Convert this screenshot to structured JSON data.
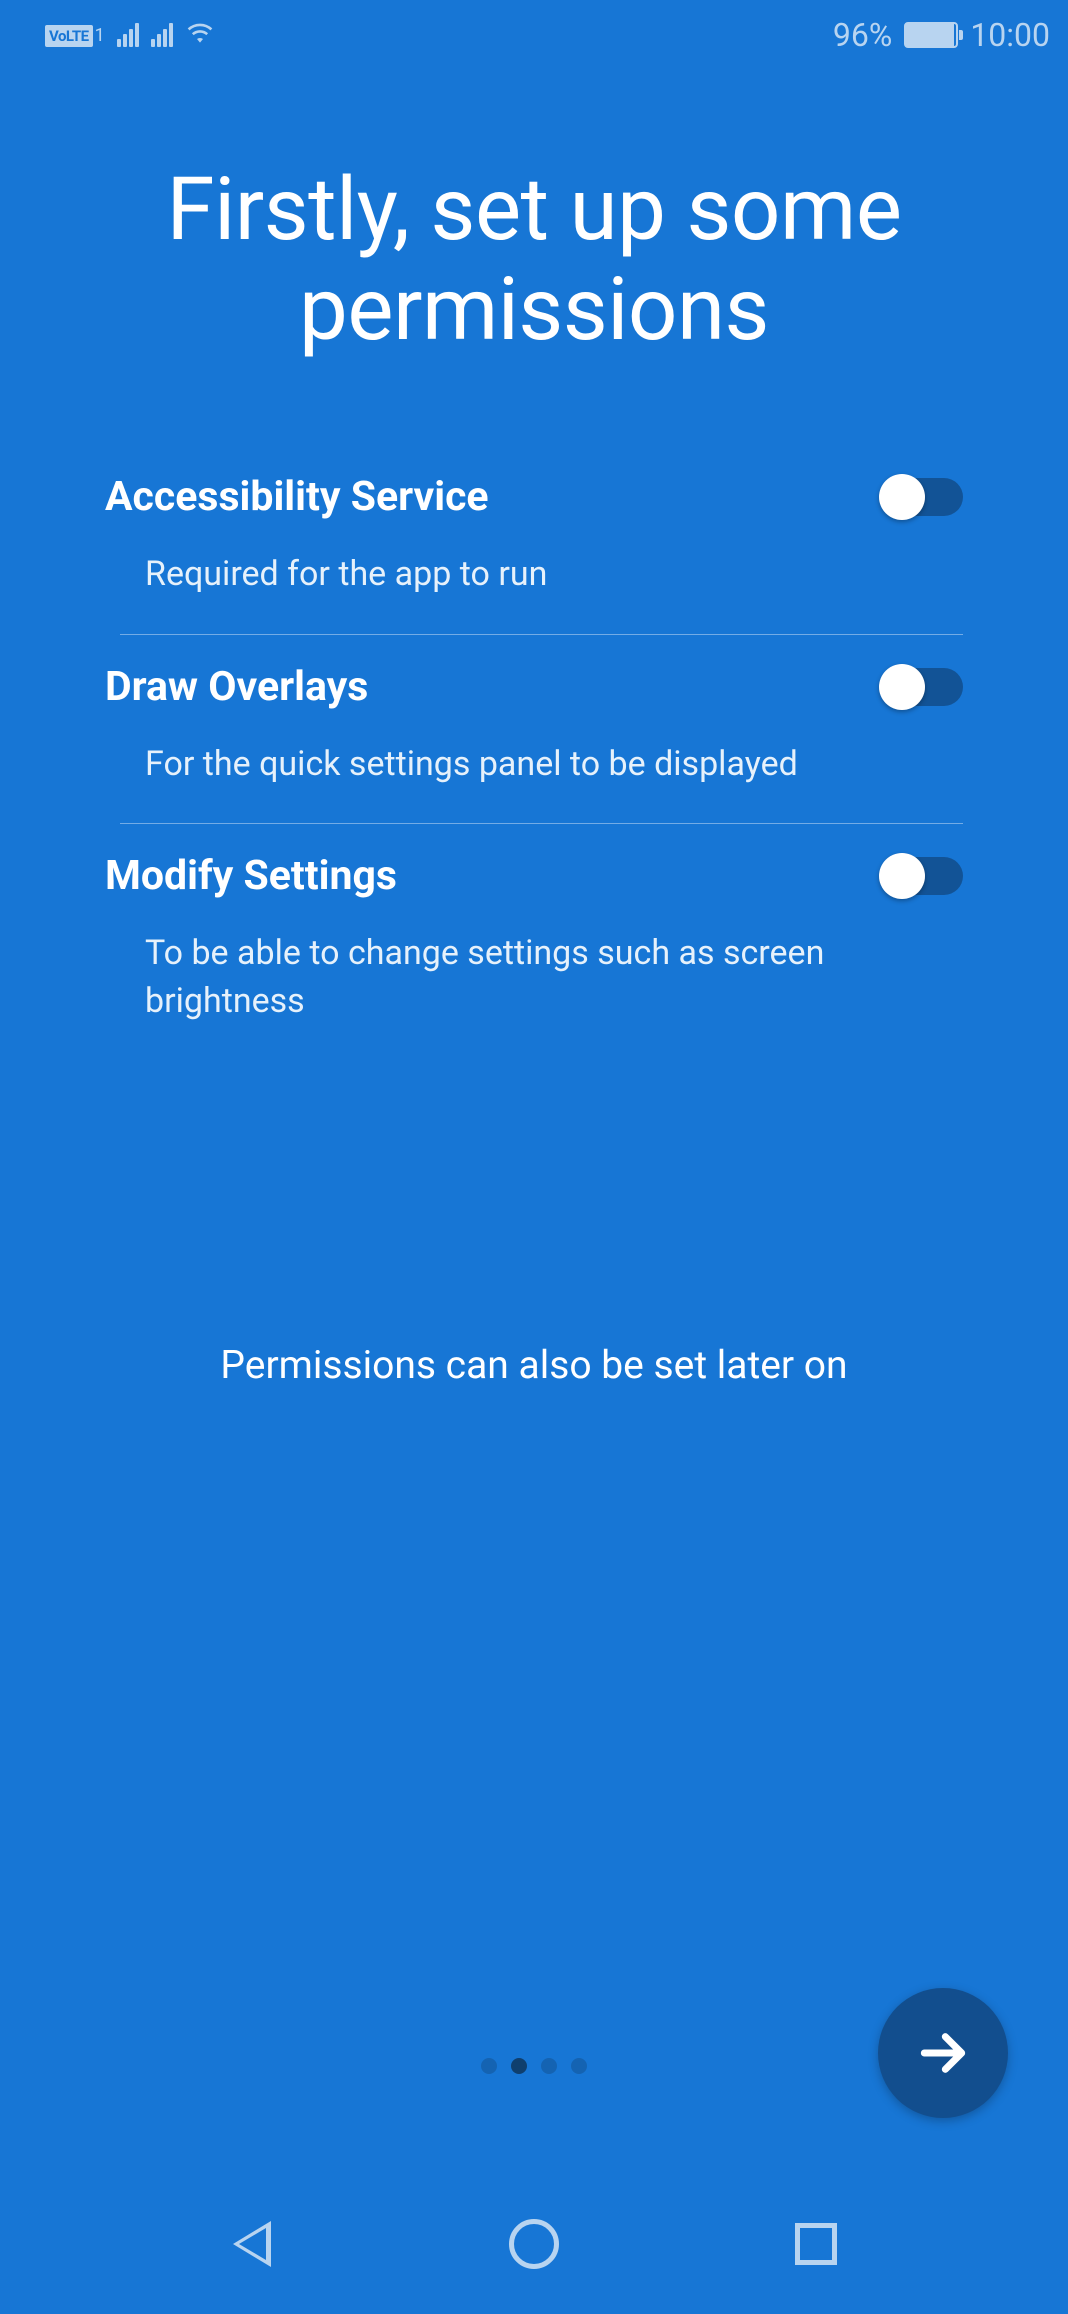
{
  "status": {
    "volte": "VoLTE",
    "sim_num": "1",
    "battery_percent": "96%",
    "time": "10:00"
  },
  "title": "Firstly, set up some permissions",
  "permissions": [
    {
      "title": "Accessibility Service",
      "desc": "Required for the app to run",
      "enabled": true
    },
    {
      "title": "Draw Overlays",
      "desc": "For the quick settings panel to be displayed",
      "enabled": true
    },
    {
      "title": "Modify Settings",
      "desc": "To be able to change settings such as screen brightness",
      "enabled": true
    }
  ],
  "footer": "Permissions can also be set later on",
  "pagination": {
    "total": 4,
    "current": 1
  }
}
